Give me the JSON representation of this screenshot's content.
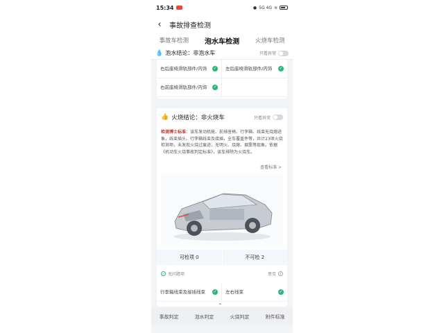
{
  "status": {
    "time": "15:34",
    "right_text": "5G 4G"
  },
  "header": {
    "title": "事故排查检测"
  },
  "tabs": [
    {
      "label": "事故车检测",
      "active": false
    },
    {
      "label": "泡水车检测",
      "active": true
    },
    {
      "label": "火烧车检测",
      "active": false
    }
  ],
  "water": {
    "label": "泡水结论：",
    "value": "非泡水车",
    "toggle_label": "只看异常"
  },
  "water_items": [
    {
      "text": "右后座椅滑轨部件/内饰",
      "ok": true
    },
    {
      "text": "左后座椅滑轨部件/内饰",
      "ok": true
    },
    {
      "text": "右前座椅滑轨部件/内饰",
      "ok": true
    }
  ],
  "fire": {
    "label": "火烧结论：",
    "value": "非火烧车",
    "toggle_label": "只看异常",
    "notice_brand": "检测博士标准",
    "notice_text": "：该车发动机舱、前排座椅、行李箱、线束无烧熔迹象，线束插头、行李箱线束及接插，全车覆盖件等，共计23项火烧检测项，未发现火烧过痕迹，无明火、烧熔、烟熏等现象。依据《机动车火烧事故判定标准》，该车排除为火烧车。",
    "more": "查看标准 >",
    "stat_ok": "可检项 0",
    "stat_na": "不可检 2",
    "ok_row_left": "无问题项",
    "ok_row_right": "意见"
  },
  "fire_items": [
    {
      "text": "行李箱线束及接插线束",
      "ok": true
    },
    {
      "text": "左右线束",
      "ok": true
    }
  ],
  "bottom_nav": [
    "事故判定",
    "泡水判定",
    "火烧判定",
    "附件标准"
  ]
}
